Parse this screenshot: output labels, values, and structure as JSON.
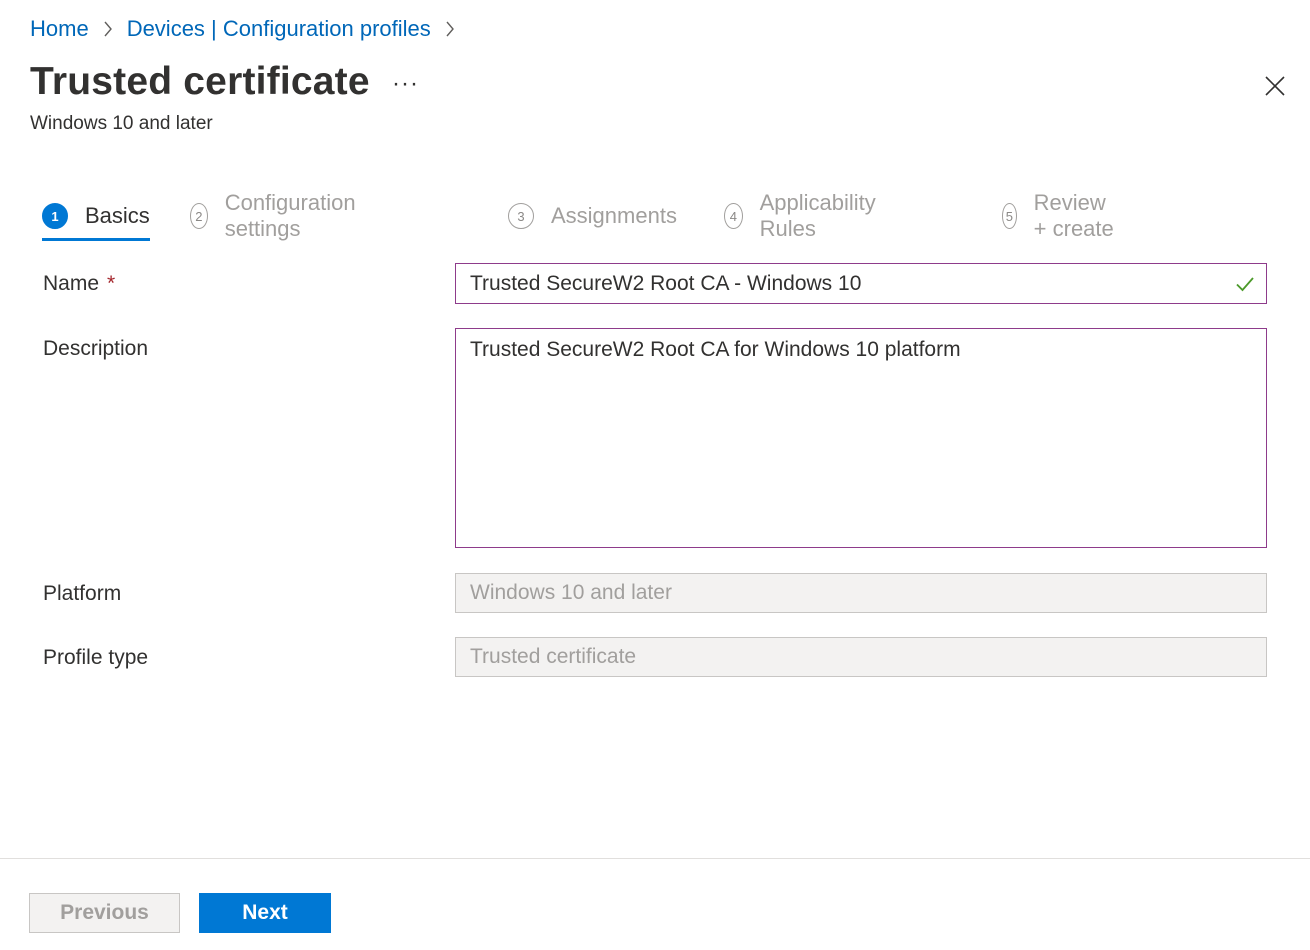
{
  "breadcrumb": {
    "items": [
      "Home",
      "Devices | Configuration profiles"
    ]
  },
  "header": {
    "title": "Trusted certificate",
    "more_label": "···",
    "subtitle": "Windows 10 and later"
  },
  "steps": [
    {
      "number": "1",
      "label": "Basics",
      "active": true
    },
    {
      "number": "2",
      "label": "Configuration settings",
      "active": false
    },
    {
      "number": "3",
      "label": "Assignments",
      "active": false
    },
    {
      "number": "4",
      "label": "Applicability Rules",
      "active": false
    },
    {
      "number": "5",
      "label": "Review + create",
      "active": false
    }
  ],
  "form": {
    "name": {
      "label": "Name",
      "required_mark": "*",
      "value": "Trusted SecureW2 Root CA - Windows 10"
    },
    "description": {
      "label": "Description",
      "value": "Trusted SecureW2 Root CA for Windows 10 platform"
    },
    "platform": {
      "label": "Platform",
      "value": "Windows 10 and later"
    },
    "profile_type": {
      "label": "Profile type",
      "value": "Trusted certificate"
    }
  },
  "footer": {
    "previous_label": "Previous",
    "next_label": "Next"
  },
  "colors": {
    "accent": "#0078d4",
    "link": "#0067b8",
    "focus_border": "#8e3b8b",
    "valid_check": "#4c9a2a",
    "required": "#a4262c"
  }
}
